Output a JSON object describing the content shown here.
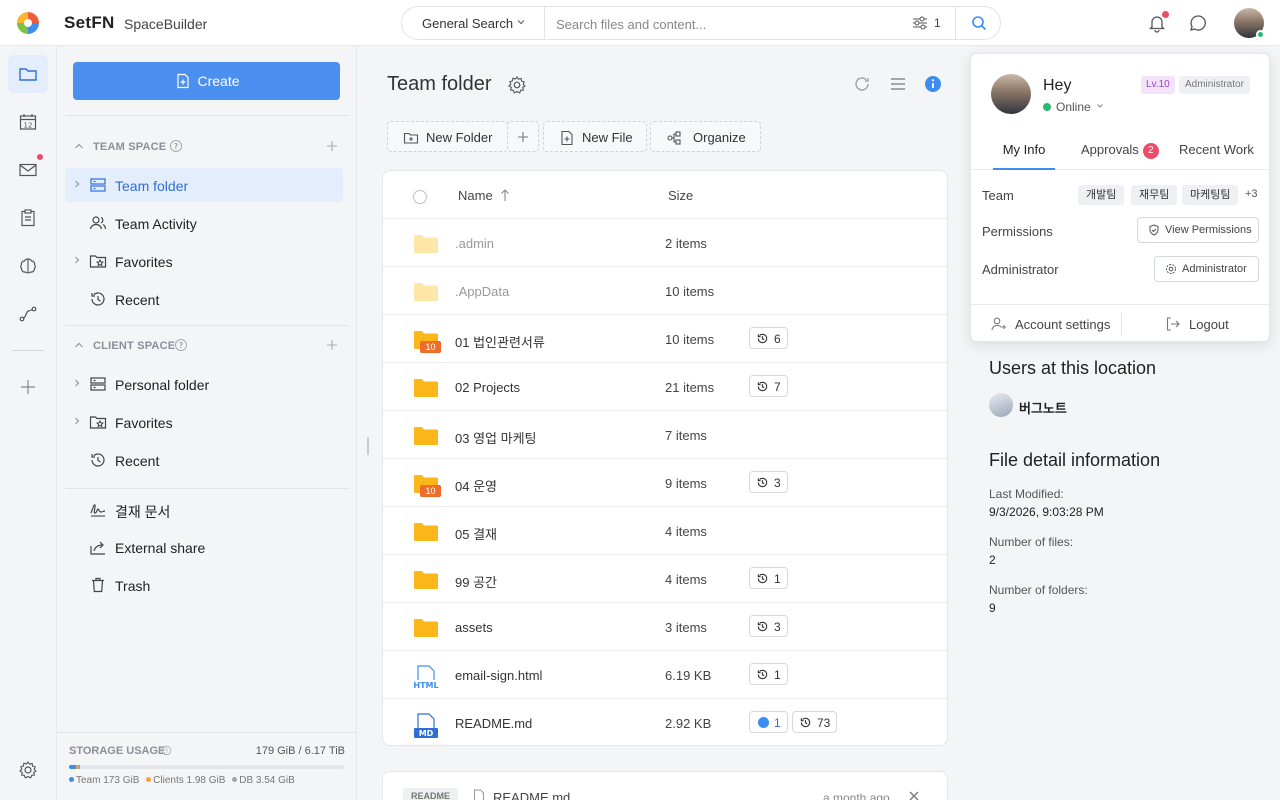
{
  "app": {
    "brand": "SetFN",
    "name": "SpaceBuilder"
  },
  "search": {
    "scope": "General Search",
    "placeholder": "Search files and content...",
    "filter_count": "1"
  },
  "rail": {
    "items": [
      {
        "icon": "folder-icon",
        "active": true
      },
      {
        "icon": "calendar-icon",
        "label": "12"
      },
      {
        "icon": "mail-icon",
        "has_dot": true
      },
      {
        "icon": "clipboard-icon"
      },
      {
        "icon": "brain-icon"
      },
      {
        "icon": "workflow-icon"
      },
      {
        "icon": "plus-icon"
      },
      {
        "icon": "gear-icon"
      }
    ]
  },
  "sidebar": {
    "create_label": "Create",
    "team_space": {
      "title": "TEAM SPACE",
      "items": [
        {
          "label": "Team folder",
          "icon": "server-icon",
          "active": true,
          "expandable": true
        },
        {
          "label": "Team Activity",
          "icon": "users-icon"
        },
        {
          "label": "Favorites",
          "icon": "star-folder-icon",
          "expandable": true
        },
        {
          "label": "Recent",
          "icon": "history-icon"
        }
      ]
    },
    "client_space": {
      "title": "CLIENT SPACE",
      "items": [
        {
          "label": "Personal folder",
          "icon": "server-icon",
          "expandable": true
        },
        {
          "label": "Favorites",
          "icon": "star-folder-icon",
          "expandable": true
        },
        {
          "label": "Recent",
          "icon": "history-icon"
        }
      ]
    },
    "misc": [
      {
        "label": "결재 문서",
        "icon": "signature-icon"
      },
      {
        "label": "External share",
        "icon": "share-icon"
      },
      {
        "label": "Trash",
        "icon": "trash-icon"
      }
    ],
    "storage": {
      "title": "STORAGE USAGE",
      "quantity": "179 GiB / 6.17 TiB",
      "team_label": "Team",
      "team_value": "173 GiB",
      "clients_label": "Clients",
      "clients_value": "1.98 GiB",
      "db_label": "DB",
      "db_value": "3.54 GiB",
      "fractions": {
        "team": 0.027,
        "clients": 0.003,
        "db": 0.006
      },
      "colors": {
        "team": "#3c8df0",
        "clients": "#f7a13b",
        "db": "#a0a6ae"
      }
    }
  },
  "main": {
    "title": "Team folder",
    "toolbar": {
      "new_folder": "New Folder",
      "new_file": "New File",
      "organize": "Organize"
    },
    "columns": {
      "name": "Name",
      "size": "Size"
    },
    "rows": [
      {
        "name": ".admin",
        "size": "2 items",
        "type": "folder-hidden"
      },
      {
        "name": ".AppData",
        "size": "10 items",
        "type": "folder-hidden"
      },
      {
        "name": "01 법인관련서류",
        "size": "10 items",
        "type": "folder-badge",
        "badge": "10",
        "versions": "6"
      },
      {
        "name": "02 Projects",
        "size": "21 items",
        "type": "folder",
        "versions": "7"
      },
      {
        "name": "03 영업 마케팅",
        "size": "7 items",
        "type": "folder"
      },
      {
        "name": "04 운영",
        "size": "9 items",
        "type": "folder-badge",
        "badge": "10",
        "versions": "3"
      },
      {
        "name": "05 결재",
        "size": "4 items",
        "type": "folder"
      },
      {
        "name": "99 공간",
        "size": "4 items",
        "type": "folder",
        "versions": "1"
      },
      {
        "name": "assets",
        "size": "3 items",
        "type": "folder",
        "versions": "3"
      },
      {
        "name": "email-sign.html",
        "size": "6.19 KB",
        "type": "html",
        "ext": "HTML",
        "versions": "1"
      },
      {
        "name": "README.md",
        "size": "2.92 KB",
        "type": "md",
        "ext": "MD",
        "comments": "1",
        "versions": "73"
      }
    ],
    "readme": {
      "tag": "README",
      "filename": "README.md",
      "when": "a month ago"
    }
  },
  "popover": {
    "greeting": "Hey",
    "status": "Online",
    "level": "Lv.10",
    "role": "Administrator",
    "tabs": {
      "my_info": "My Info",
      "approvals": "Approvals",
      "approvals_count": "2",
      "recent_work": "Recent Work"
    },
    "team_label": "Team",
    "teams": [
      "개발팀",
      "재무팀",
      "마케팅팀"
    ],
    "teams_more": "+3",
    "permissions_label": "Permissions",
    "view_permissions": "View Permissions",
    "admin_label": "Administrator",
    "admin_button": "Administrator",
    "account_settings": "Account settings",
    "logout": "Logout"
  },
  "details": {
    "users_title": "Users at this location",
    "user_name": "버그노트",
    "file_title": "File detail information",
    "last_modified_label": "Last Modified:",
    "last_modified": "9/3/2026, 9:03:28 PM",
    "num_files_label": "Number of files:",
    "num_files": "2",
    "num_folders_label": "Number of folders:",
    "num_folders": "9"
  }
}
